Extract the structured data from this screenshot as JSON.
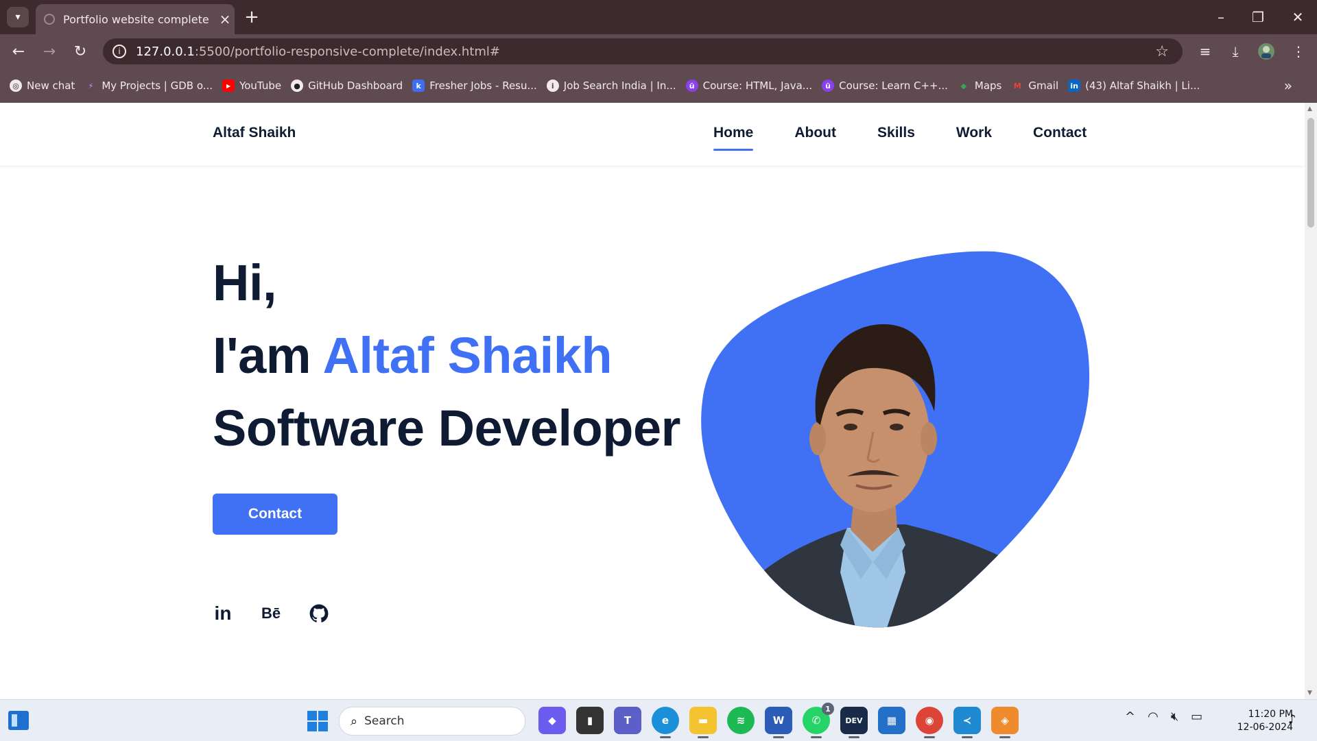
{
  "browser": {
    "tab_title": "Portfolio website complete",
    "url_host": "127.0.0.1",
    "url_path": ":5500/portfolio-responsive-complete/index.html#",
    "bookmarks": [
      {
        "label": "New chat",
        "icon": "chatgpt-icon",
        "color": "#ffffff"
      },
      {
        "label": "My Projects | GDB o...",
        "icon": "bolt-icon",
        "color": "#7b5cf0"
      },
      {
        "label": "YouTube",
        "icon": "youtube-icon",
        "color": "#ff0000"
      },
      {
        "label": "GitHub Dashboard",
        "icon": "github-icon",
        "color": "#222222"
      },
      {
        "label": "Fresher Jobs - Resu...",
        "icon": "jobs-icon",
        "color": "#3e6ef0"
      },
      {
        "label": "Job Search India | In...",
        "icon": "info-icon",
        "color": "#ffffff"
      },
      {
        "label": "Course: HTML, Java...",
        "icon": "course-icon",
        "color": "#8a3ff0"
      },
      {
        "label": "Course: Learn C++...",
        "icon": "course-icon",
        "color": "#8a3ff0"
      },
      {
        "label": "Maps",
        "icon": "maps-icon",
        "color": "#34a853"
      },
      {
        "label": "Gmail",
        "icon": "gmail-icon",
        "color": "#ea4335"
      },
      {
        "label": "(43) Altaf Shaikh | Li...",
        "icon": "linkedin-icon",
        "color": "#0a66c2"
      }
    ]
  },
  "site": {
    "logo": "Altaf Shaikh",
    "nav": [
      "Home",
      "About",
      "Skills",
      "Work",
      "Contact"
    ],
    "active_nav": "Home",
    "hero": {
      "greeting": "Hi,",
      "intro_prefix": "I'am ",
      "name": "Altaf Shaikh",
      "role": "Software Developer",
      "cta_label": "Contact"
    },
    "social": [
      {
        "name": "linkedin-icon",
        "glyph": "in"
      },
      {
        "name": "behance-icon",
        "glyph": "Bē"
      },
      {
        "name": "github-icon",
        "glyph": ""
      }
    ],
    "accent_color": "#4070f4",
    "text_color": "#0e1b33"
  },
  "taskbar": {
    "search_placeholder": "Search",
    "apps": [
      {
        "name": "copilot-icon",
        "label": "",
        "color": "#6b5cf0"
      },
      {
        "name": "file-explorer-dark-icon",
        "label": "",
        "color": "#333333"
      },
      {
        "name": "teams-icon",
        "label": "T",
        "color": "#5b5fc7"
      },
      {
        "name": "edge-icon",
        "label": "e",
        "color": "#1b8fd8"
      },
      {
        "name": "file-explorer-icon",
        "label": "",
        "color": "#f4c430"
      },
      {
        "name": "spotify-icon",
        "label": "",
        "color": "#1db954"
      },
      {
        "name": "word-icon",
        "label": "W",
        "color": "#2b5cb8"
      },
      {
        "name": "whatsapp-icon",
        "label": "",
        "color": "#25d366"
      },
      {
        "name": "dev-icon",
        "label": "DEV",
        "color": "#1a2b4a"
      },
      {
        "name": "store-icon",
        "label": "",
        "color": "#2470c8"
      },
      {
        "name": "chrome-icon",
        "label": "",
        "color": "#db4437"
      },
      {
        "name": "vscode-icon",
        "label": "",
        "color": "#1f8ad2"
      },
      {
        "name": "git-icon",
        "label": "",
        "color": "#ef8a2d"
      }
    ],
    "whatsapp_badge": "1",
    "time": "11:20 PM",
    "date": "12-06-2024"
  }
}
